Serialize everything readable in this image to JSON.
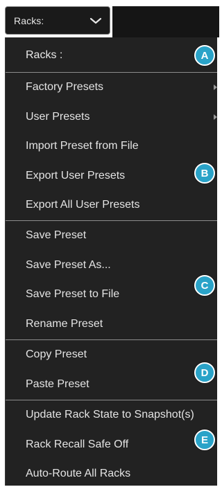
{
  "dropdown": {
    "label": "Racks:"
  },
  "menu": {
    "header": "Racks :",
    "sections": [
      {
        "badge": "B",
        "items": [
          {
            "label": "Factory Presets",
            "submenu": true
          },
          {
            "label": "User Presets",
            "submenu": true
          },
          {
            "label": "Import Preset from File",
            "submenu": false
          },
          {
            "label": "Export User Presets",
            "submenu": false
          },
          {
            "label": "Export All User Presets",
            "submenu": false
          }
        ]
      },
      {
        "badge": "C",
        "items": [
          {
            "label": "Save Preset"
          },
          {
            "label": "Save Preset As..."
          },
          {
            "label": "Save Preset to File"
          },
          {
            "label": "Rename Preset"
          }
        ]
      },
      {
        "badge": "D",
        "items": [
          {
            "label": "Copy Preset"
          },
          {
            "label": "Paste Preset"
          }
        ]
      },
      {
        "badge": "E",
        "items": [
          {
            "label": "Update Rack State to Snapshot(s)"
          },
          {
            "label": "Rack Recall Safe Off"
          },
          {
            "label": "Auto-Route All Racks"
          }
        ]
      }
    ],
    "header_badge": "A"
  },
  "colors": {
    "menu_bg": "#222222",
    "text": "#e4e4e4",
    "divider": "#8d8d8d",
    "badge": "#2aa3c8"
  }
}
